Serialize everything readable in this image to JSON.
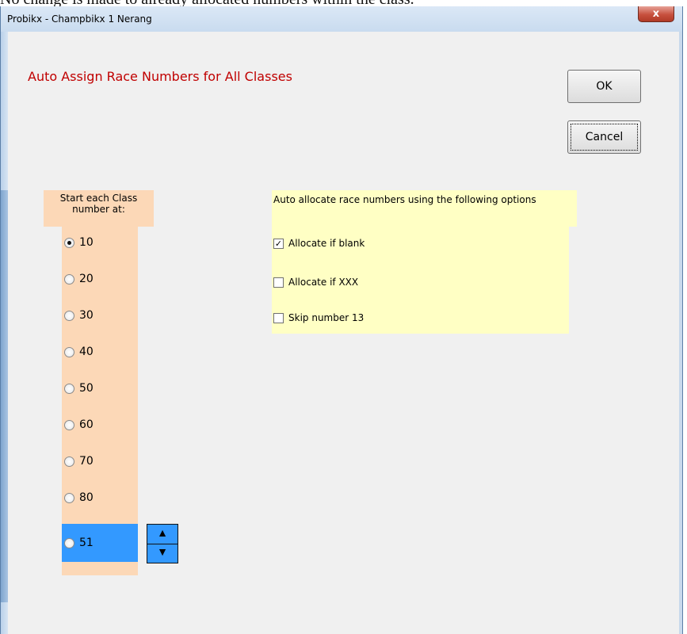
{
  "background_text": "No change is made to already allocated numbers within the class.",
  "window": {
    "title": "Probikx - Champbikx 1 Nerang",
    "close_symbol": "x"
  },
  "dialog": {
    "heading": "Auto Assign Race Numbers for All Classes",
    "ok_label": "OK",
    "cancel_label": "Cancel"
  },
  "start_numbers": {
    "header": "Start each Class number at:",
    "options": [
      {
        "label": "10",
        "selected": true
      },
      {
        "label": "20",
        "selected": false
      },
      {
        "label": "30",
        "selected": false
      },
      {
        "label": "40",
        "selected": false
      },
      {
        "label": "50",
        "selected": false
      },
      {
        "label": "60",
        "selected": false
      },
      {
        "label": "70",
        "selected": false
      },
      {
        "label": "80",
        "selected": false
      }
    ],
    "custom": {
      "label": "51",
      "selected": false
    },
    "spinner": {
      "up_symbol": "▲",
      "down_symbol": "▼"
    }
  },
  "allocation_options": {
    "header": "Auto allocate race numbers using the following options",
    "items": [
      {
        "label": "Allocate if blank",
        "checked": true
      },
      {
        "label": "Allocate if XXX",
        "checked": false
      },
      {
        "label": "Skip number 13",
        "checked": false
      }
    ]
  },
  "colors": {
    "heading_red": "#c00000",
    "start_panel": "#fcd8b7",
    "options_panel": "#ffffc4",
    "selection_blue": "#3399ff"
  }
}
